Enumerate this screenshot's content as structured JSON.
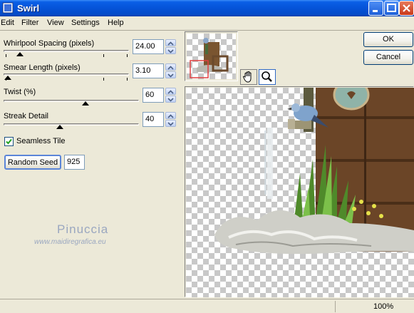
{
  "window": {
    "title": "Swirl"
  },
  "menu": [
    "Edit",
    "Filter",
    "View",
    "Settings",
    "Help"
  ],
  "params": [
    {
      "label": "Whirlpool Spacing (pixels)",
      "value": "24.00",
      "level": 0.13
    },
    {
      "label": "Smear Length (pixels)",
      "value": "3.10",
      "level": 0.01
    },
    {
      "label": "Twist (%)",
      "value": "60",
      "level": 0.6
    },
    {
      "label": "Streak Detail",
      "value": "40",
      "level": 0.4
    }
  ],
  "seamless": {
    "label": "Seamless Tile",
    "checked": true
  },
  "random_seed": {
    "button": "Random Seed",
    "value": "925"
  },
  "buttons": {
    "ok": "OK",
    "cancel": "Cancel"
  },
  "watermark": {
    "name": "Pinuccia",
    "url": "www.maidiregrafica.eu"
  },
  "status": {
    "zoom": "100%"
  },
  "colors": {
    "title_blue": "#0553d8",
    "face": "#ece9d8",
    "navigator_frame": "#e04040"
  },
  "icons": {
    "pan": "hand-icon",
    "zoom": "magnifier-icon"
  }
}
